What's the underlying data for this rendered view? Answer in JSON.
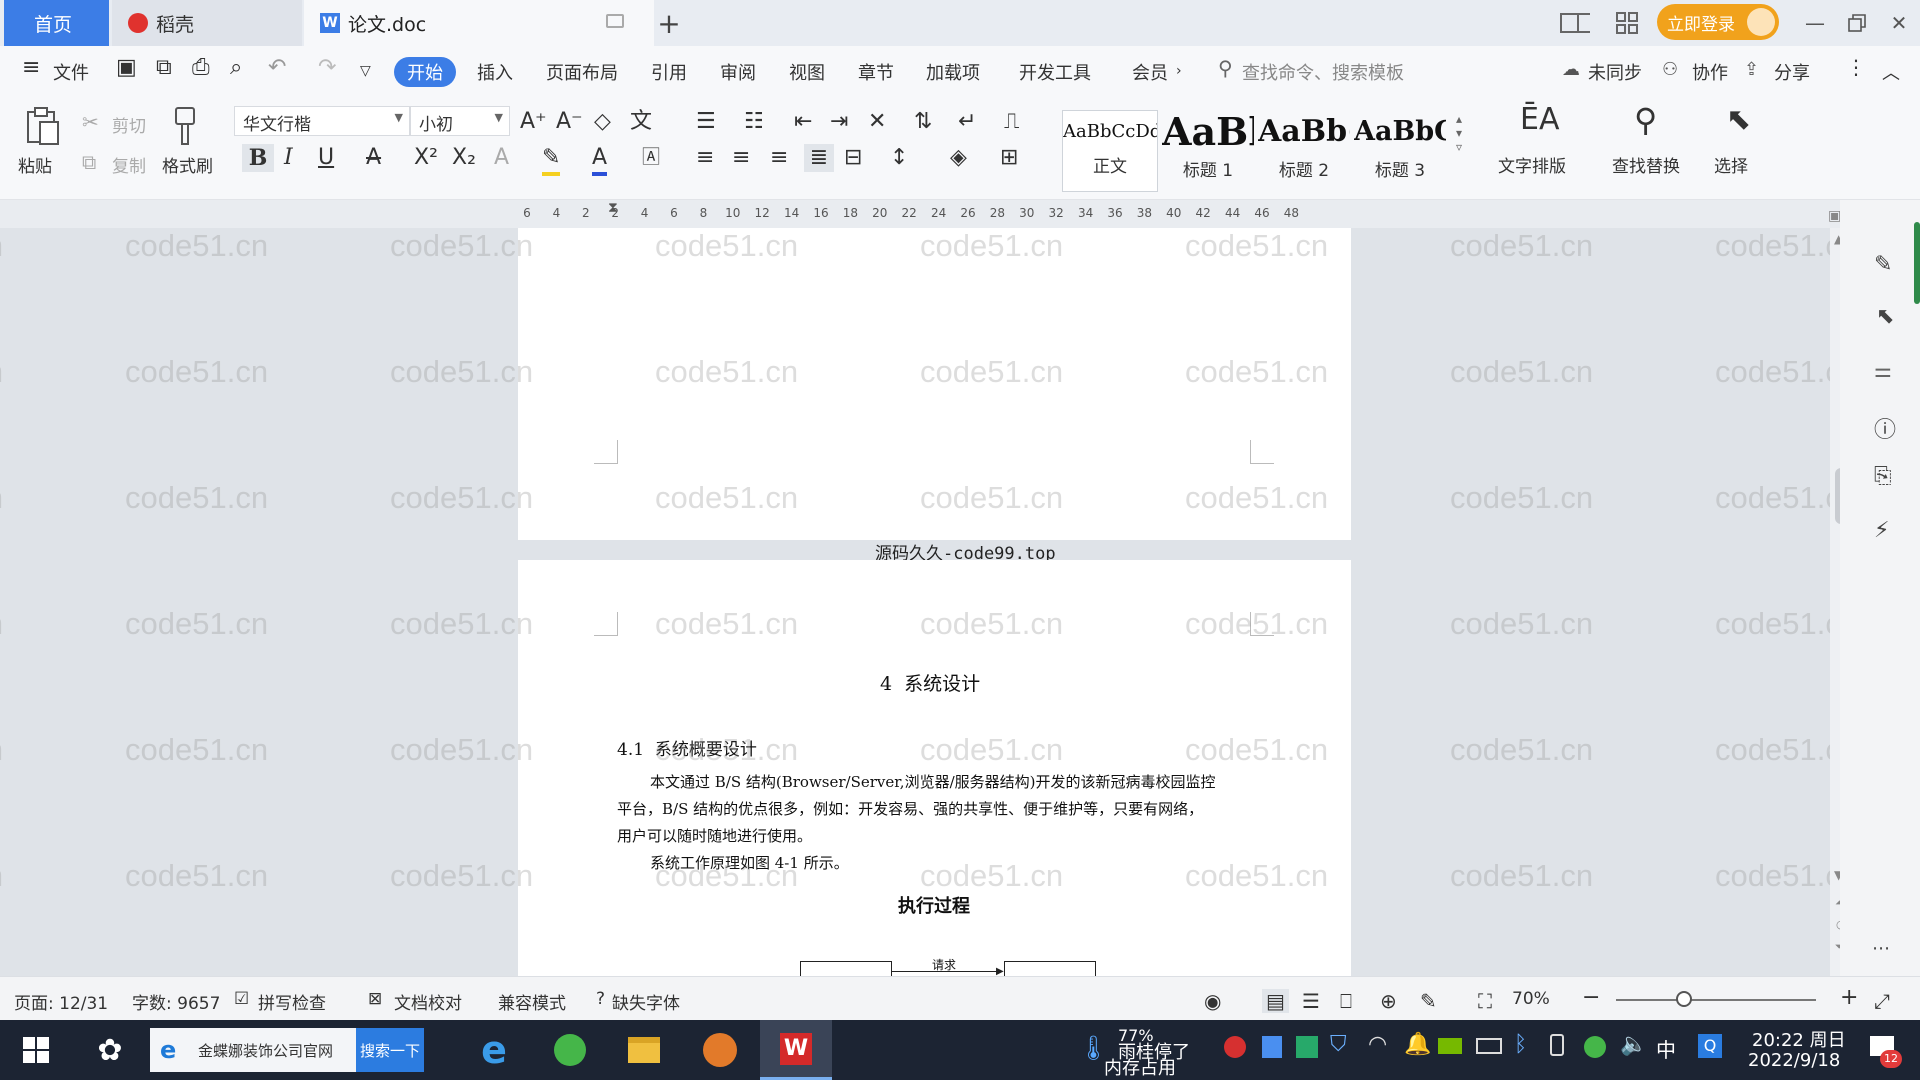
{
  "titlebar": {
    "tabs": [
      {
        "label": "首页"
      },
      {
        "label": "稻壳"
      },
      {
        "label": "论文.doc"
      }
    ],
    "login_label": "立即登录"
  },
  "menubar": {
    "file": "文件",
    "items": [
      "开始",
      "插入",
      "页面布局",
      "引用",
      "审阅",
      "视图",
      "章节",
      "加载项",
      "开发工具",
      "会员"
    ],
    "search_placeholder": "查找命令、搜索模板",
    "sync": "未同步",
    "collab": "协作",
    "share": "分享"
  },
  "ribbon": {
    "paste": "粘贴",
    "cut": "剪切",
    "copy": "复制",
    "format_painter": "格式刷",
    "font_name": "华文行楷",
    "font_size": "小初",
    "styles": [
      {
        "sample": "AaBbCcDd",
        "label": "正文"
      },
      {
        "sample": "AaBl",
        "label": "标题 1"
      },
      {
        "sample": "AaBb(",
        "label": "标题 2"
      },
      {
        "sample": "AaBbC",
        "label": "标题 3"
      }
    ],
    "text_layout": "文字排版",
    "find_replace": "查找替换",
    "select": "选择"
  },
  "ruler": {
    "ticks": [
      "6",
      "4",
      "2",
      "2",
      "4",
      "6",
      "8",
      "10",
      "12",
      "14",
      "16",
      "18",
      "20",
      "22",
      "24",
      "26",
      "28",
      "30",
      "32",
      "34",
      "36",
      "38",
      "40",
      "42",
      "44",
      "46",
      "48"
    ]
  },
  "document": {
    "page_footer": "源码久久-code99.top",
    "heading1": "4  系统设计",
    "heading2": "4.1  系统概要设计",
    "para_lines": [
      "本文通过 B/S 结构(Browser/Server,浏览器/服务器结构)开发的该新冠病毒校园监控",
      "平台，B/S 结构的优点很多，例如：开发容易、强的共享性、便于维护等，只要有网络，",
      "用户可以随时随地进行使用。"
    ],
    "para2": "系统工作原理如图 4-1 所示。",
    "figure_title": "执行过程",
    "diagram_label": "请求",
    "watermark": "code51.cn"
  },
  "statusbar": {
    "page": "页面: 12/31",
    "words": "字数: 9657",
    "spell": "拼写检查",
    "doc_check": "文档校对",
    "compat": "兼容模式",
    "missing_font": "缺失字体",
    "zoom": "70%"
  },
  "taskbar": {
    "search_text": "金蝶娜装饰公司官网",
    "search_btn": "搜索一下",
    "mem_pct": "77%",
    "mem_line1": "雨桂停了",
    "mem_line2": "内存占用",
    "ime": "中",
    "time": "20:22 周日",
    "date": "2022/9/18",
    "notif_count": "12"
  }
}
